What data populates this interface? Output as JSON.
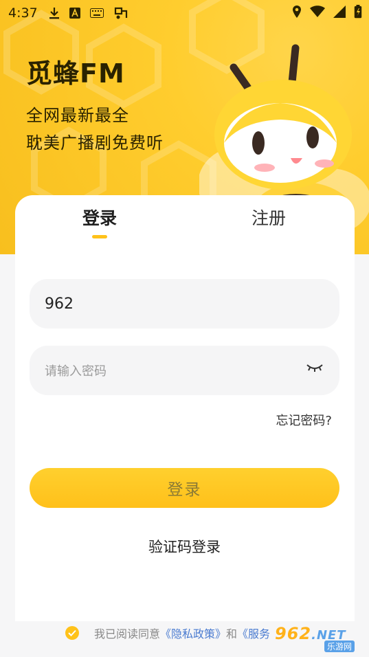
{
  "status_bar": {
    "time": "4:37",
    "left_icons": [
      "download-icon",
      "a-notification-icon",
      "keyboard-icon",
      "app-notification-icon"
    ],
    "right_icons": [
      "location-icon",
      "wifi-icon",
      "signal-icon",
      "battery-icon"
    ]
  },
  "header": {
    "app_name": "觅蜂FM",
    "slogan_line1": "全网最新最全",
    "slogan_line2": "耽美广播剧免费听"
  },
  "tabs": [
    {
      "label": "登录",
      "active": true
    },
    {
      "label": "注册",
      "active": false
    }
  ],
  "form": {
    "phone_value": "962",
    "password_placeholder": "请输入密码",
    "forgot_password": "忘记密码?",
    "login_button": "登录",
    "sms_login": "验证码登录"
  },
  "agreement": {
    "prefix": "我已阅读同意",
    "privacy_link": "《隐私政策》",
    "and": "和",
    "service_link": "《服务"
  },
  "watermark": {
    "brand": "962",
    "domain": ".NET",
    "sub": "乐游网"
  },
  "colors": {
    "accent": "#ffc21a",
    "link": "#4a7bd0"
  }
}
